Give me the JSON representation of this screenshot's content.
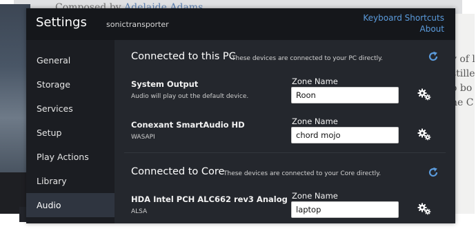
{
  "background": {
    "top_text": "Composed by",
    "top_link": "Adelaide Adams",
    "right_lines": [
      "y of l",
      "stille",
      "o bo",
      "he C"
    ]
  },
  "header": {
    "title": "Settings",
    "subtitle": "sonictransporter",
    "links": {
      "keyboard_shortcuts": "Keyboard Shortcuts",
      "about": "About"
    }
  },
  "sidebar": {
    "items": [
      {
        "label": "General"
      },
      {
        "label": "Storage"
      },
      {
        "label": "Services"
      },
      {
        "label": "Setup"
      },
      {
        "label": "Play Actions"
      },
      {
        "label": "Library"
      },
      {
        "label": "Audio"
      }
    ],
    "active": "Audio"
  },
  "sections": {
    "pc": {
      "title": "Connected to this PC",
      "description": "These devices are connected to your PC directly.",
      "devices": [
        {
          "name": "System Output",
          "subtitle": "Audio will play out the default device.",
          "zone_label": "Zone Name",
          "zone_value": "Roon"
        },
        {
          "name": "Conexant SmartAudio HD",
          "subtitle": "WASAPI",
          "zone_label": "Zone Name",
          "zone_value": "chord mojo"
        }
      ]
    },
    "core": {
      "title": "Connected to Core",
      "description": "These devices are connected to your Core directly.",
      "devices": [
        {
          "name": "HDA Intel PCH ALC662 rev3 Analog",
          "subtitle": "ALSA",
          "zone_label": "Zone Name",
          "zone_value": "laptop"
        }
      ]
    }
  },
  "icons": {
    "refresh": "refresh-icon",
    "device_settings": "gears-icon"
  },
  "colors": {
    "accent": "#5b9bdc",
    "header_bg": "#15171b",
    "content_bg": "#24272d",
    "sidebar_bg": "#1b1d22",
    "active_nav_bg": "#2f3540"
  }
}
